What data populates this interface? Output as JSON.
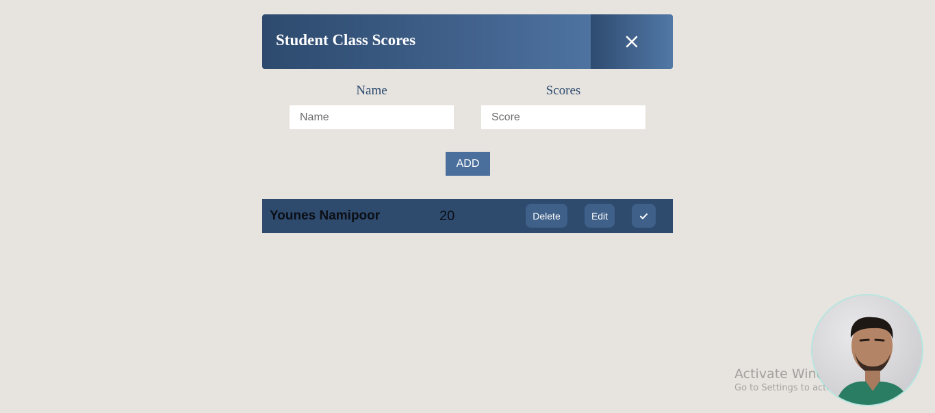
{
  "header": {
    "title": "Student Class Scores",
    "close_icon": "close-icon"
  },
  "form": {
    "name_label": "Name",
    "name_placeholder": "Name",
    "name_value": "",
    "score_label": "Scores",
    "score_placeholder": "Score",
    "score_value": "",
    "add_label": "ADD"
  },
  "students": [
    {
      "name": "Younes Namipoor",
      "score": "20",
      "delete_label": "Delete",
      "edit_label": "Edit",
      "check_icon": "checkmark-icon"
    }
  ],
  "watermark": {
    "title": "Activate Windows",
    "subtitle": "Go to Settings to activate Windows."
  },
  "colors": {
    "background": "#e7e4df",
    "primary_dark": "#2d4a6e",
    "primary": "#4a6f9c",
    "row_background": "#2e4a6d",
    "button": "#3f6089"
  }
}
